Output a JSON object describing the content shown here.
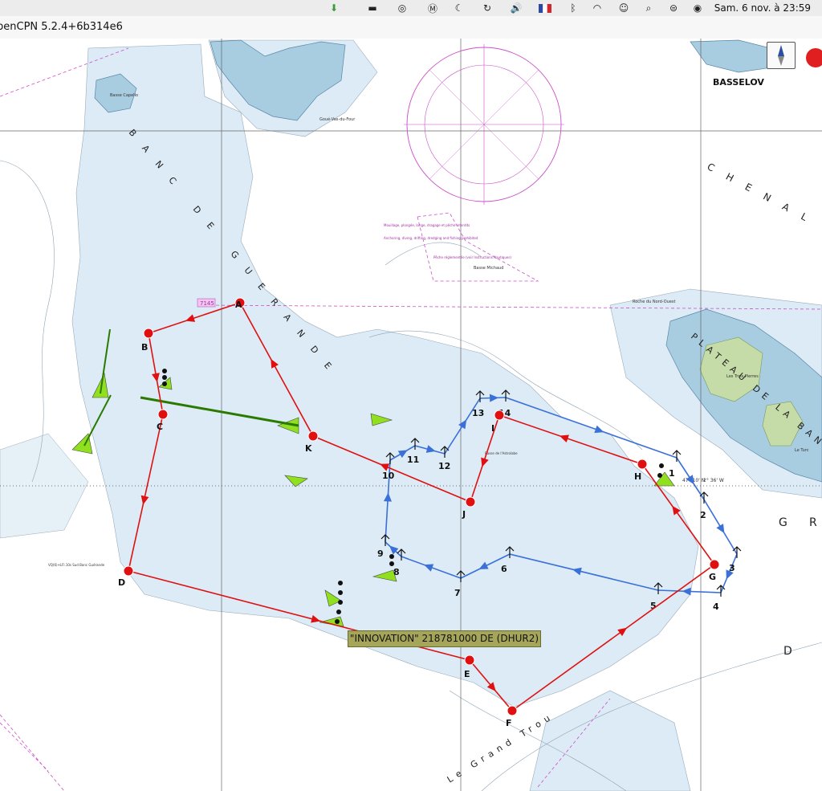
{
  "menubar": {
    "clock": "Sam. 6 nov. à  23:59",
    "icons": [
      "download-icon",
      "display-icon",
      "creative-cloud-icon",
      "malwarebytes-icon",
      "moon-icon",
      "time-machine-icon",
      "volume-icon",
      "flag-fr-icon",
      "bluetooth-icon",
      "wifi-icon",
      "user-icon",
      "search-icon",
      "control-center-icon",
      "siri-icon"
    ],
    "flag_colors": {
      "blue": "#2b4aa0",
      "white": "#ffffff",
      "red": "#d0292d"
    }
  },
  "window": {
    "title": "penCPN 5.2.4+6b314e6"
  },
  "colors": {
    "route_red": "#e01010",
    "route_blue": "#3a70d8",
    "land": "#a8cce0",
    "shallow": "#dcebf5",
    "deep": "#ffffff",
    "magenta": "#cc4fc9",
    "ais_green": "#90e020",
    "island": "#c5dca8"
  },
  "chart": {
    "area_names": [
      "BANC DE GUERANDE",
      "PLATEAU DE LA BANCHE",
      "CHENAL",
      "Le Grand Trou"
    ],
    "place_labels": {
      "basselov": "BASSELOV",
      "gouel": "Goué-Vas-du-Four",
      "basse_capello": "Basse Capello",
      "basse_michaud": "Basse Michaud",
      "roche_nord_ouest": "Roche du Nord-Ouest",
      "trois_pierres": "Les Trois Pierres",
      "le_turc": "Le Turc",
      "grid_7145": "7145",
      "lat_label": "47° 10' N",
      "lon_label": "2° 36' W",
      "edge_g": "G",
      "edge_d": "D",
      "edge_r": "R"
    },
    "zone_notes": {
      "mouillage": "Mouillage, plongée, longe, dragage et pêche interdits",
      "anchoring": "Anchoring, diving, drifting, dredging and fishing prohibited",
      "peche": "Pêche réglementée (voir Instructions Nautiques)",
      "buoy_astrolabe": "Basse de l'Astrolabe",
      "vq_light": "VQ(6)+LFl.10s Sud Banc Guérande"
    },
    "red_route": {
      "waypoints": [
        {
          "name": "A"
        },
        {
          "name": "B"
        },
        {
          "name": "C"
        },
        {
          "name": "D"
        },
        {
          "name": "E"
        },
        {
          "name": "F"
        },
        {
          "name": "G"
        },
        {
          "name": "H"
        },
        {
          "name": "I"
        },
        {
          "name": "J"
        },
        {
          "name": "K"
        }
      ]
    },
    "blue_route": {
      "waypoints": [
        {
          "name": "1"
        },
        {
          "name": "2"
        },
        {
          "name": "3"
        },
        {
          "name": "4"
        },
        {
          "name": "5"
        },
        {
          "name": "6"
        },
        {
          "name": "7"
        },
        {
          "name": "8"
        },
        {
          "name": "9"
        },
        {
          "name": "10"
        },
        {
          "name": "11"
        },
        {
          "name": "12"
        },
        {
          "name": "13"
        },
        {
          "name": "14"
        }
      ]
    },
    "ais_target": {
      "label": "\"INNOVATION\" 218781000 DE (DHUR2)"
    }
  }
}
